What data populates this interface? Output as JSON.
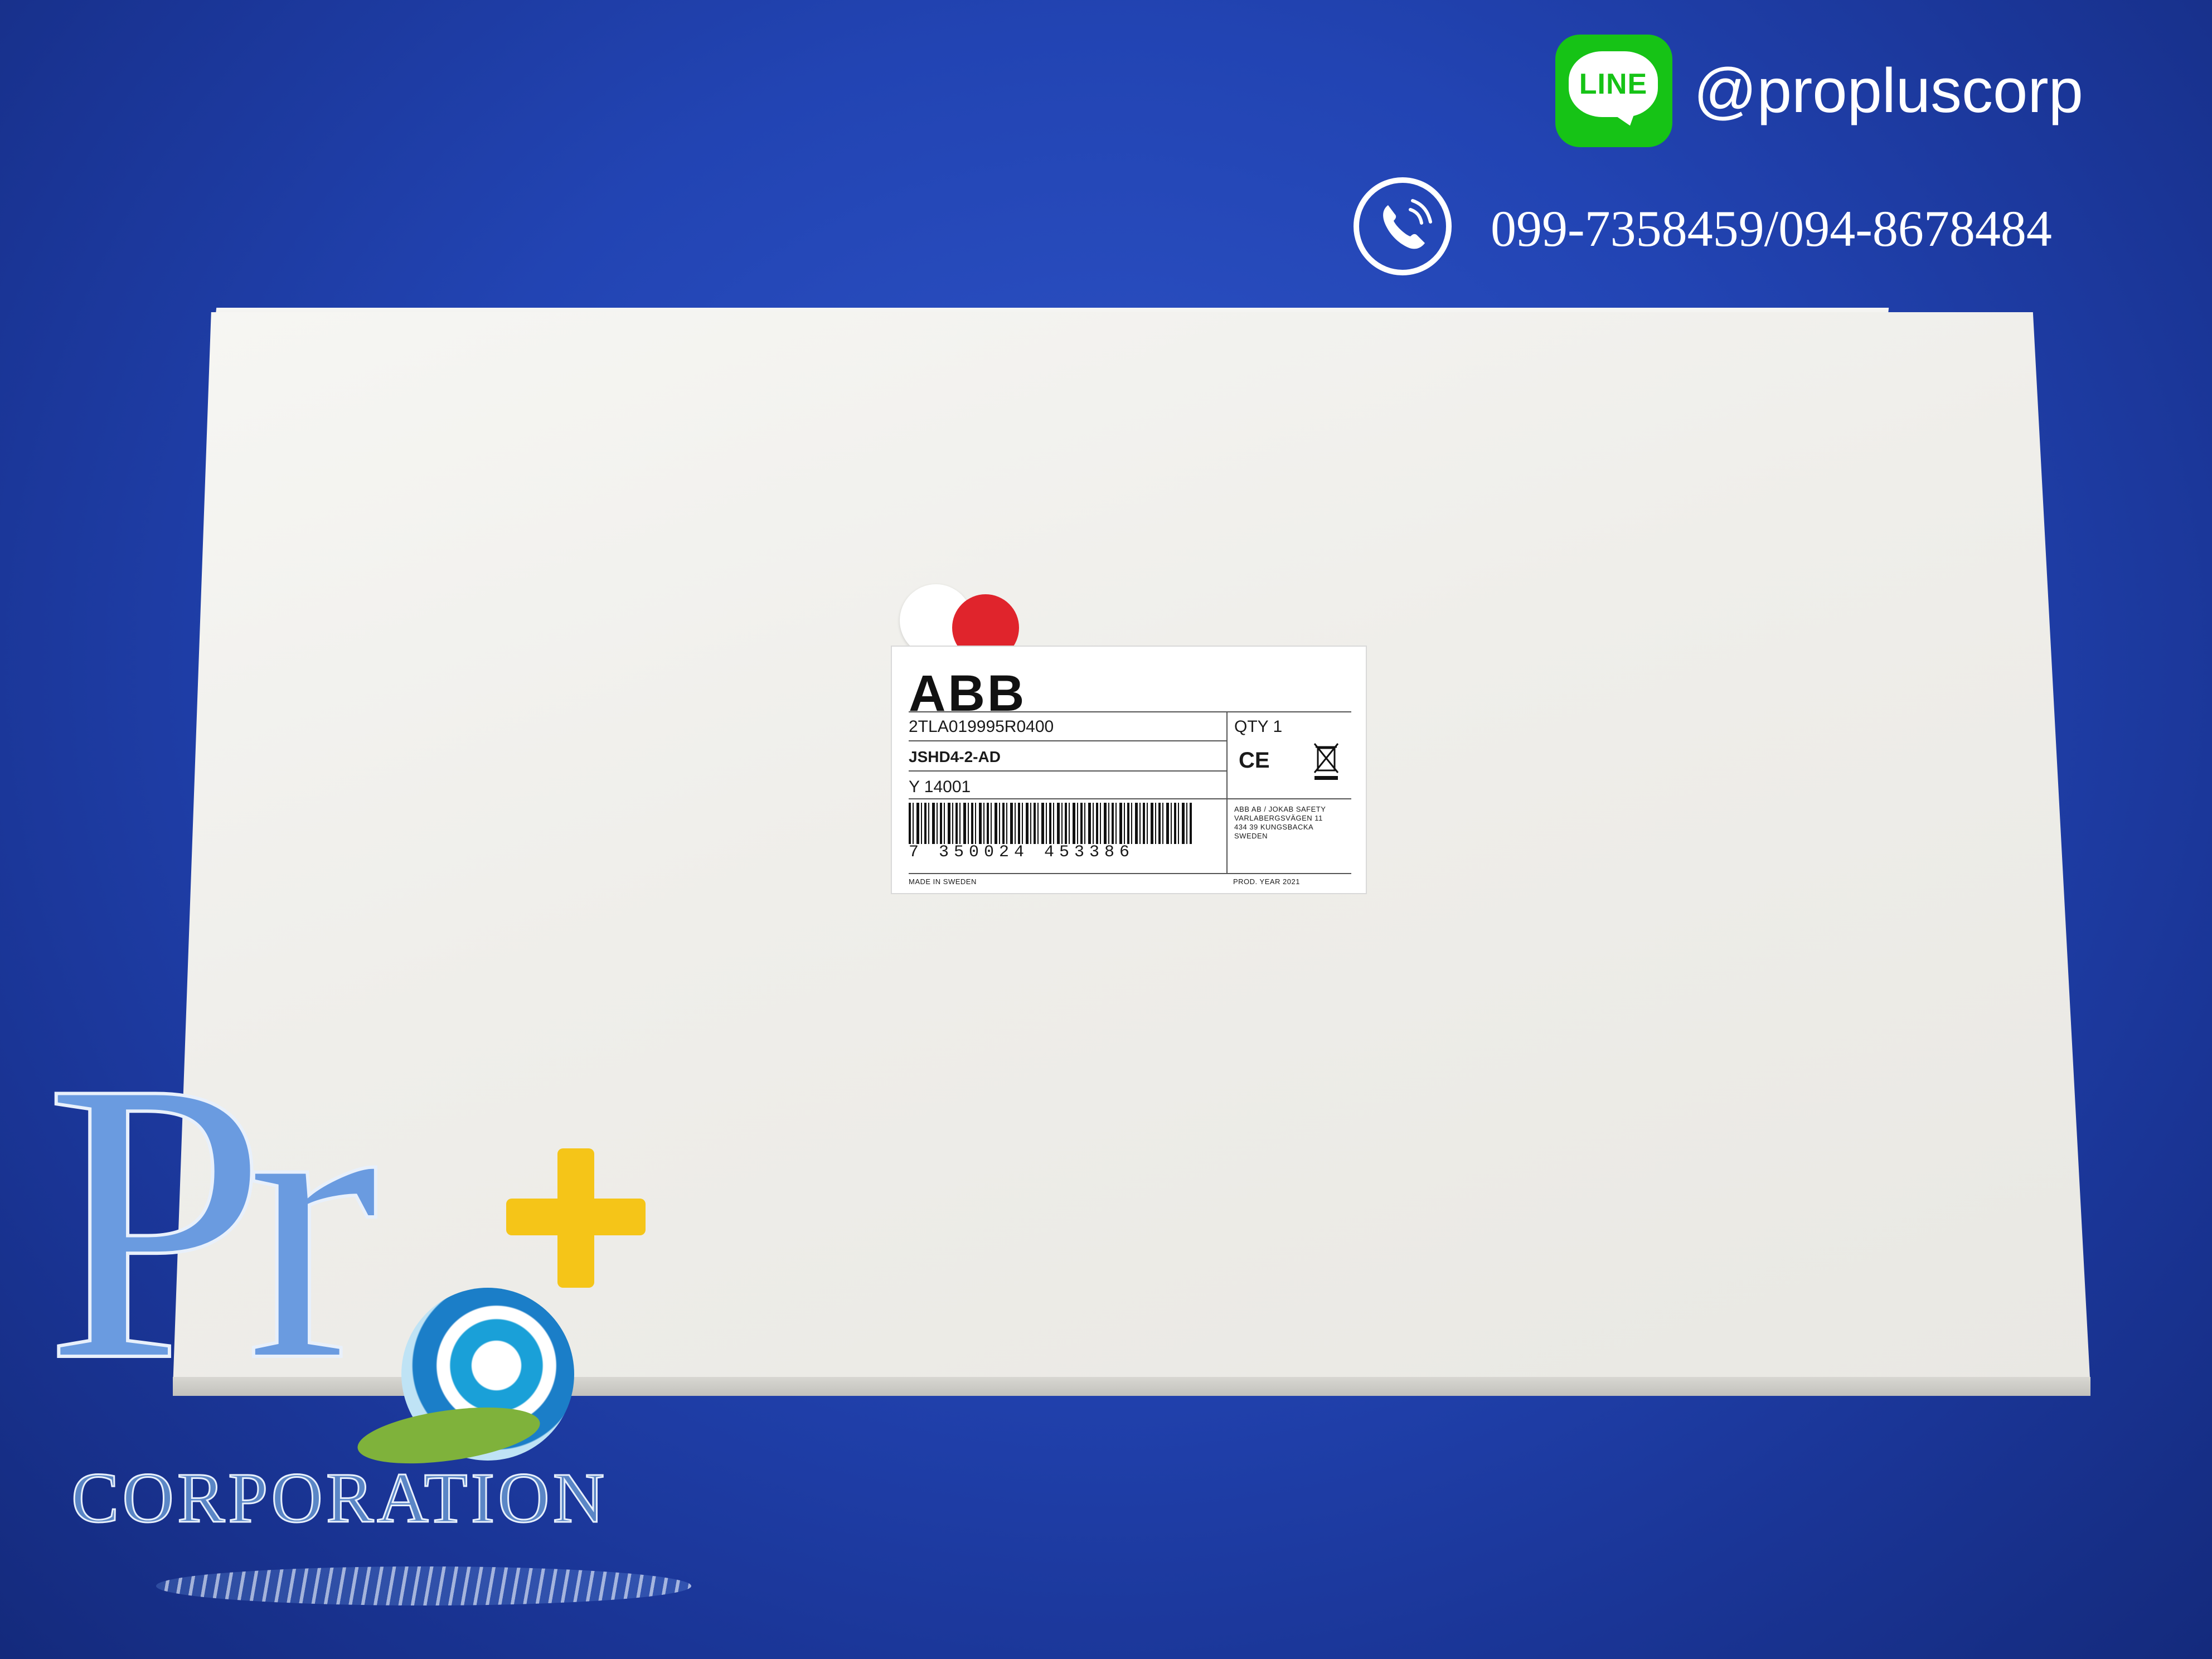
{
  "header": {
    "line_badge": "LINE",
    "line_handle": "@propluscorp",
    "phone_numbers": "099-7358459/094-8678484"
  },
  "label": {
    "brand": "ABB",
    "part_number": "2TLA019995R0400",
    "model": "JSHD4-2-AD",
    "code": "Y 14001",
    "qty": "QTY 1",
    "ce": "CE",
    "barcode_digits": "7 350024 453386",
    "address_line1": "ABB AB / JOKAB SAFETY",
    "address_line2": "VARLABERGSVÄGEN 11",
    "address_line3": "434 39 KUNGSBACKA",
    "address_line4": "SWEDEN",
    "made_in": "MADE IN SWEDEN",
    "prod_year": "PROD. YEAR 2021"
  },
  "logo": {
    "pro": "Pr",
    "corporation": "CORPORATION"
  },
  "colors": {
    "background": "#2244b3",
    "line_green": "#16c316",
    "dot_red": "#e0242c",
    "plus_yellow": "#f5c518",
    "logo_blue": "#6a9be0"
  }
}
